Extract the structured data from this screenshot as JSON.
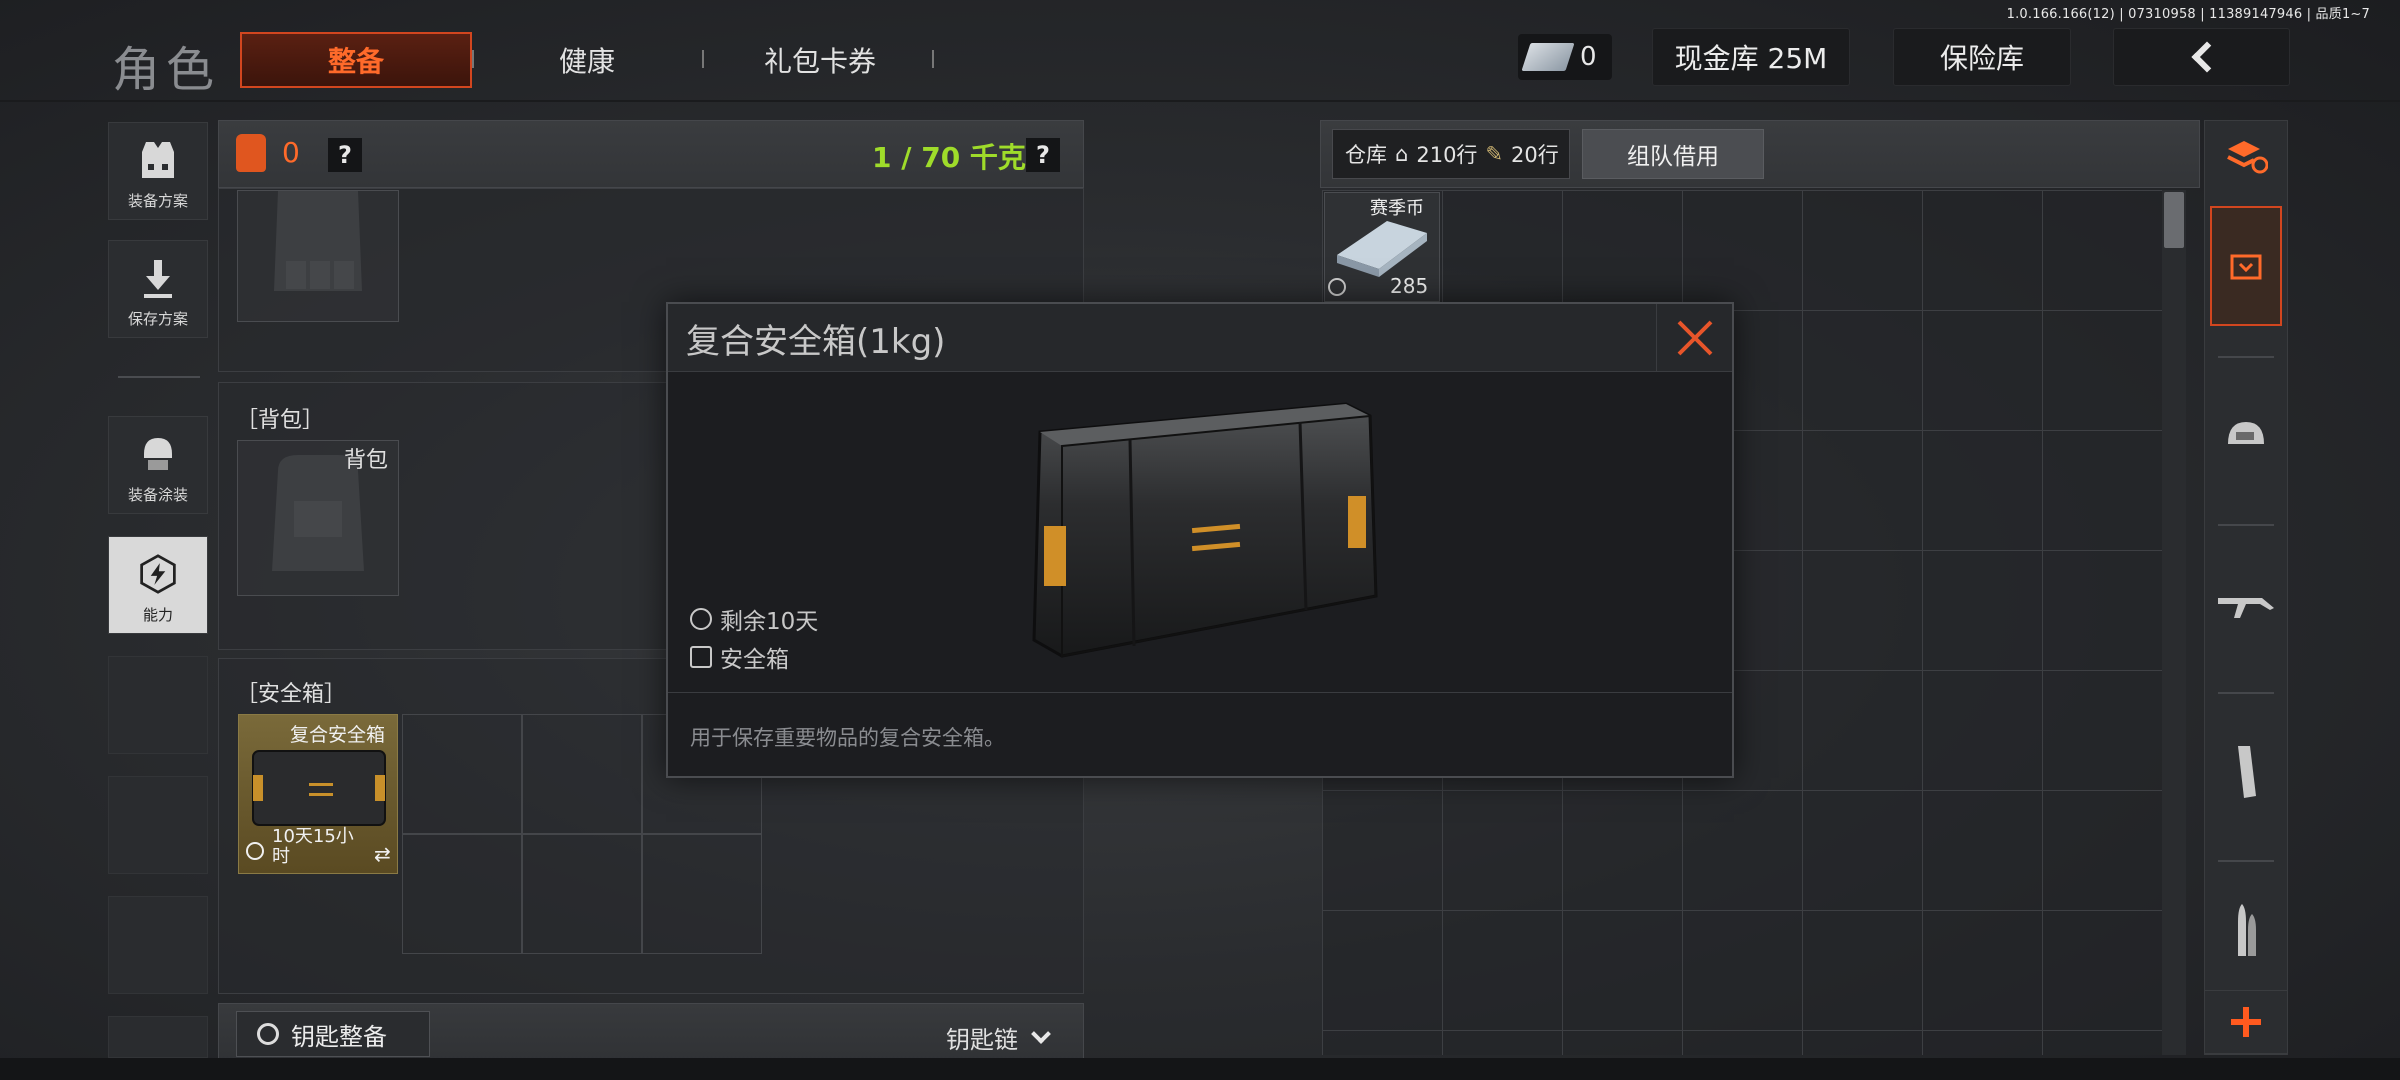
{
  "version": "1.0.166.166(12) | 07310958 | 11389147946 | 品质1~7",
  "header": {
    "title": "角色",
    "tabs": [
      {
        "label": "整备",
        "active": true
      },
      {
        "label": "健康",
        "active": false
      },
      {
        "label": "礼包卡券",
        "active": false
      }
    ],
    "cash_count": "0",
    "cash_vault_label": "现金库 25M",
    "safe_vault_label": "保险库"
  },
  "side_menu": {
    "items": [
      {
        "label": "装备方案",
        "icon": "vest-icon"
      },
      {
        "label": "保存方案",
        "icon": "download-icon"
      },
      {
        "label": "装备涂装",
        "icon": "helmet-icon"
      },
      {
        "label": "能力",
        "icon": "lightning-icon",
        "active": true
      }
    ]
  },
  "loadout": {
    "armor_count": "0",
    "help": "?",
    "weight": "1 / 70 千克",
    "backpack_section": "［背包］",
    "backpack_slot_label": "背包",
    "safebox_section": "［安全箱］",
    "safebox_item_name": "复合安全箱",
    "safebox_item_time": "10天15小",
    "safebox_item_time2": "时",
    "keys_button": "钥匙整备",
    "keys_link": "钥匙链"
  },
  "stash": {
    "label": "仓库",
    "rows_home": "210行",
    "rows_extra": "20行",
    "team_borrow": "组队借用",
    "coin_item": {
      "name": "赛季币",
      "count": "285"
    }
  },
  "popup": {
    "title": "复合安全箱(1kg)",
    "remaining": "剩余10天",
    "type": "安全箱",
    "description": "用于保存重要物品的复合安全箱。"
  },
  "colors": {
    "accent": "#ff6a2a",
    "weight_green": "#9fdc2a",
    "safebox_bg": "#6b5a2e"
  }
}
